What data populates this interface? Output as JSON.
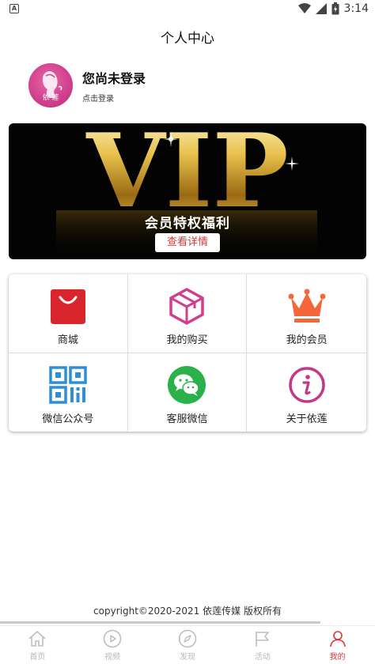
{
  "status_bar": {
    "time": "3:14"
  },
  "header": {
    "title": "个人中心"
  },
  "profile": {
    "name": "您尚未登录",
    "subtitle": "点击登录",
    "avatar_text": "依 莲"
  },
  "banner": {
    "big_text": "VIP",
    "title": "会员特权福利",
    "button_label": "查看详情"
  },
  "grid": {
    "items": [
      {
        "label": "商城",
        "icon": "shopping-bag-icon"
      },
      {
        "label": "我的购买",
        "icon": "package-box-icon"
      },
      {
        "label": "我的会员",
        "icon": "crown-icon"
      },
      {
        "label": "微信公众号",
        "icon": "qr-code-icon"
      },
      {
        "label": "客服微信",
        "icon": "wechat-icon"
      },
      {
        "label": "关于依莲",
        "icon": "info-icon"
      }
    ]
  },
  "footer": {
    "copyright": "copyright©2020-2021 依莲传媒 版权所有"
  },
  "tabbar": {
    "items": [
      {
        "label": "首页",
        "icon": "home-icon"
      },
      {
        "label": "视频",
        "icon": "play-icon"
      },
      {
        "label": "发现",
        "icon": "compass-icon"
      },
      {
        "label": "活动",
        "icon": "flag-icon"
      },
      {
        "label": "我的",
        "icon": "user-icon",
        "active": true
      }
    ]
  },
  "colors": {
    "accent": "#d9393c",
    "pink": "#cf3f8c",
    "orange": "#f4673a",
    "green": "#2ab14a",
    "blue": "#2f8fd6"
  }
}
